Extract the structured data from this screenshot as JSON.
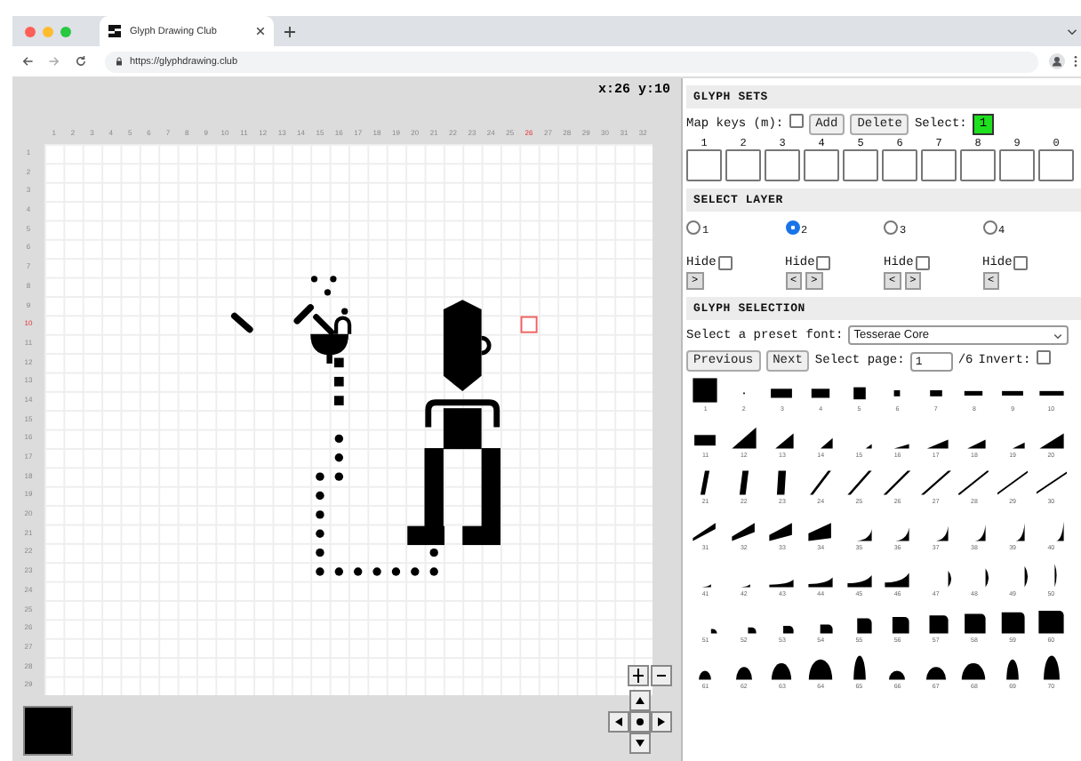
{
  "browser": {
    "tab_title": "Glyph Drawing Club",
    "url": "https://glyphdrawing.club"
  },
  "canvas": {
    "cursor_readout": "x:26 y:10",
    "columns": [
      {
        "label": "1",
        "active": false
      },
      {
        "label": "2",
        "active": false
      },
      {
        "label": "3",
        "active": false
      },
      {
        "label": "4",
        "active": false
      },
      {
        "label": "5",
        "active": false
      },
      {
        "label": "6",
        "active": false
      },
      {
        "label": "7",
        "active": false
      },
      {
        "label": "8",
        "active": false
      },
      {
        "label": "9",
        "active": false
      },
      {
        "label": "10",
        "active": false
      },
      {
        "label": "11",
        "active": false
      },
      {
        "label": "12",
        "active": false
      },
      {
        "label": "13",
        "active": false
      },
      {
        "label": "14",
        "active": false
      },
      {
        "label": "15",
        "active": false
      },
      {
        "label": "16",
        "active": false
      },
      {
        "label": "17",
        "active": false
      },
      {
        "label": "18",
        "active": false
      },
      {
        "label": "19",
        "active": false
      },
      {
        "label": "20",
        "active": false
      },
      {
        "label": "21",
        "active": false
      },
      {
        "label": "22",
        "active": false
      },
      {
        "label": "23",
        "active": false
      },
      {
        "label": "24",
        "active": false
      },
      {
        "label": "25",
        "active": false
      },
      {
        "label": "26",
        "active": true
      },
      {
        "label": "27",
        "active": false
      },
      {
        "label": "28",
        "active": false
      },
      {
        "label": "29",
        "active": false
      },
      {
        "label": "30",
        "active": false
      },
      {
        "label": "31",
        "active": false
      },
      {
        "label": "32",
        "active": false
      }
    ],
    "rows": [
      {
        "label": "1",
        "active": false
      },
      {
        "label": "2",
        "active": false
      },
      {
        "label": "3",
        "active": false
      },
      {
        "label": "4",
        "active": false
      },
      {
        "label": "5",
        "active": false
      },
      {
        "label": "6",
        "active": false
      },
      {
        "label": "7",
        "active": false
      },
      {
        "label": "8",
        "active": false
      },
      {
        "label": "9",
        "active": false
      },
      {
        "label": "10",
        "active": true
      },
      {
        "label": "11",
        "active": false
      },
      {
        "label": "12",
        "active": false
      },
      {
        "label": "13",
        "active": false
      },
      {
        "label": "14",
        "active": false
      },
      {
        "label": "15",
        "active": false
      },
      {
        "label": "16",
        "active": false
      },
      {
        "label": "17",
        "active": false
      },
      {
        "label": "18",
        "active": false
      },
      {
        "label": "19",
        "active": false
      },
      {
        "label": "20",
        "active": false
      },
      {
        "label": "21",
        "active": false
      },
      {
        "label": "22",
        "active": false
      },
      {
        "label": "23",
        "active": false
      },
      {
        "label": "24",
        "active": false
      },
      {
        "label": "25",
        "active": false
      },
      {
        "label": "26",
        "active": false
      },
      {
        "label": "27",
        "active": false
      },
      {
        "label": "28",
        "active": false
      },
      {
        "label": "29",
        "active": false
      }
    ]
  },
  "glyph_sets": {
    "title": "GLYPH SETS",
    "map_keys_label": "Map keys (m):",
    "map_keys_checked": false,
    "buttons": [
      "Add",
      "Delete"
    ],
    "select_label": "Select:",
    "active_set": "1",
    "slots": [
      "1",
      "2",
      "3",
      "4",
      "5",
      "6",
      "7",
      "8",
      "9",
      "0"
    ]
  },
  "select_layer": {
    "title": "SELECT LAYER",
    "layers": [
      {
        "label": "1",
        "selected": false,
        "hide_label": "Hide",
        "hidden": false,
        "arrows": [
          ">"
        ]
      },
      {
        "label": "2",
        "selected": true,
        "hide_label": "Hide",
        "hidden": false,
        "arrows": [
          "<",
          ">"
        ]
      },
      {
        "label": "3",
        "selected": false,
        "hide_label": "Hide",
        "hidden": false,
        "arrows": [
          "<",
          ">"
        ]
      },
      {
        "label": "4",
        "selected": false,
        "hide_label": "Hide",
        "hidden": false,
        "arrows": [
          "<"
        ]
      }
    ]
  },
  "glyph_selection": {
    "title": "GLYPH SELECTION",
    "preset_label": "Select a preset font:",
    "preset_value": "Tesserae Core",
    "previous": "Previous",
    "next": "Next",
    "page_label": "Select page:",
    "page_value": "1",
    "page_total": "/6",
    "invert_label": "Invert:",
    "inverted": false,
    "glyphs": [
      "1",
      "2",
      "3",
      "4",
      "5",
      "6",
      "7",
      "8",
      "9",
      "10",
      "11",
      "12",
      "13",
      "14",
      "15",
      "16",
      "17",
      "18",
      "19",
      "20",
      "21",
      "22",
      "23",
      "24",
      "25",
      "26",
      "27",
      "28",
      "29",
      "30",
      "31",
      "32",
      "33",
      "34",
      "35",
      "36",
      "37",
      "38",
      "39",
      "40",
      "41",
      "42",
      "43",
      "44",
      "45",
      "46",
      "47",
      "48",
      "49",
      "50",
      "51",
      "52",
      "53",
      "54",
      "55",
      "56",
      "57",
      "58",
      "59",
      "60",
      "61",
      "62",
      "63",
      "64",
      "65",
      "66",
      "67",
      "68",
      "69",
      "70"
    ]
  }
}
